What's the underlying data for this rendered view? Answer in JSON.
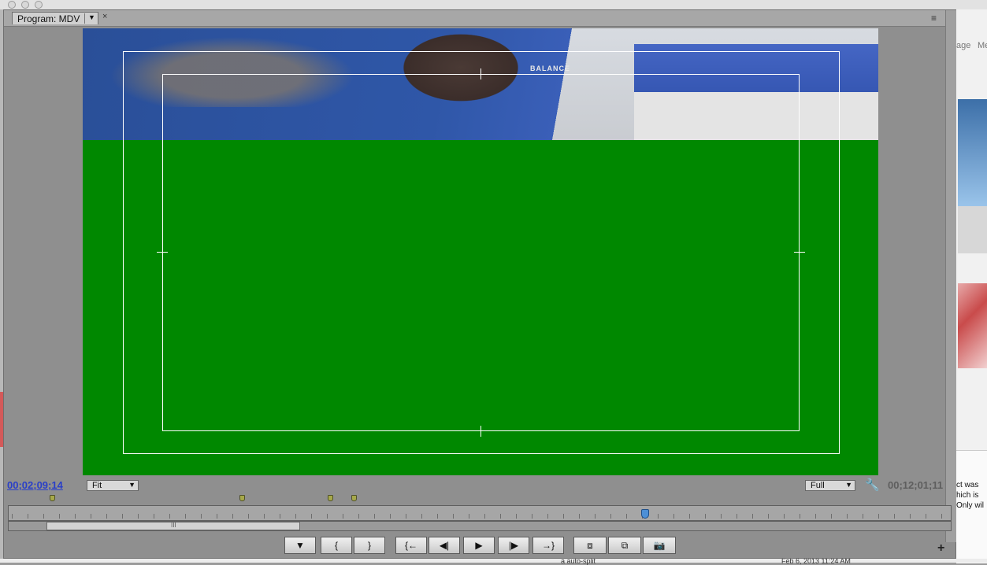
{
  "panel": {
    "tab_label": "Program: MDV",
    "tab_menu_arrow": "▼",
    "tab_close": "×",
    "menu_icon": "≡"
  },
  "video": {
    "sign_text": "BALANCE"
  },
  "timeline": {
    "current_timecode": "00;02;09;14",
    "duration_timecode": "00;12;01;11",
    "zoom_select": "Fit",
    "resolution_select": "Full",
    "dropdown_arrow": "▼",
    "zoom_grip": "III"
  },
  "transport": {
    "add_marker": "▼",
    "mark_in": "{",
    "mark_out": "}",
    "go_to_in": "{←",
    "step_back": "◀|",
    "play": "▶",
    "step_forward": "|▶",
    "go_to_out": "→}",
    "lift": "⧈",
    "extract": "⧉",
    "export_frame": "📷",
    "add_button": "+"
  },
  "background": {
    "right_text_1": "age",
    "right_text_2": "Me",
    "panel_lines": [
      "ct was",
      "hich is",
      "Only wil"
    ],
    "bottom_text_1": "a auto-split",
    "bottom_text_2": "Feb 6, 2013 11:24 AM"
  }
}
